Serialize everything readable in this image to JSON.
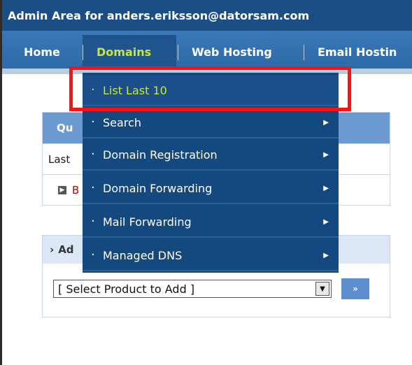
{
  "header": {
    "title": "Admin Area for anders.eriksson@datorsam.com"
  },
  "nav": {
    "items": [
      {
        "label": "Home",
        "active": false
      },
      {
        "label": "Domains",
        "active": true
      },
      {
        "label": "Web Hosting",
        "active": false
      },
      {
        "label": "Email Hostin",
        "active": false
      }
    ],
    "separator": "|"
  },
  "panels": {
    "quick": {
      "header": "Qu",
      "row1": "Last",
      "row2_text": "B"
    },
    "add": {
      "header": "Ad",
      "select_value": "[ Select Product to Add ]",
      "go_label": "»"
    }
  },
  "menu": {
    "items": [
      {
        "label": "List Last 10",
        "submenu": false,
        "highlighted": true
      },
      {
        "label": "Search",
        "submenu": true,
        "highlighted": false
      },
      {
        "label": "Domain Registration",
        "submenu": true,
        "highlighted": false
      },
      {
        "label": "Domain Forwarding",
        "submenu": true,
        "highlighted": false
      },
      {
        "label": "Mail Forwarding",
        "submenu": true,
        "highlighted": false
      },
      {
        "label": "Managed DNS",
        "submenu": true,
        "highlighted": false
      }
    ]
  },
  "colors": {
    "title_bar": "#1b4e85",
    "nav_bar": "#3a78b8",
    "menu_bg": "#14497f",
    "active_text": "#c8e63c",
    "highlight_border": "#ff1111"
  }
}
